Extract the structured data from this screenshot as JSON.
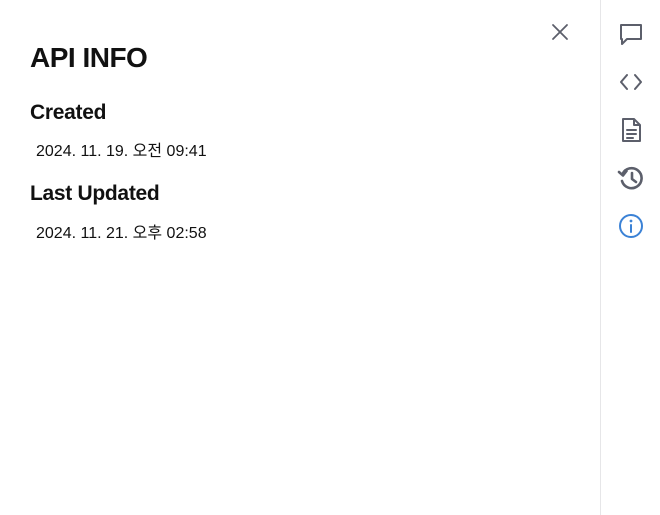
{
  "panel": {
    "title": "API INFO",
    "close_icon": "close-icon",
    "sections": [
      {
        "heading": "Created",
        "value": "2024. 11. 19. 오전 09:41"
      },
      {
        "heading": "Last Updated",
        "value": "2024. 11. 21. 오후 02:58"
      }
    ]
  },
  "rail": {
    "items": [
      {
        "icon": "comment-icon",
        "active": false
      },
      {
        "icon": "code-icon",
        "active": false
      },
      {
        "icon": "document-icon",
        "active": false
      },
      {
        "icon": "history-icon",
        "active": false
      },
      {
        "icon": "info-icon",
        "active": true
      }
    ]
  },
  "colors": {
    "icon_default": "#5c5f6b",
    "icon_active": "#3b82d6",
    "divider": "#e6e6e8",
    "text": "#111111"
  }
}
